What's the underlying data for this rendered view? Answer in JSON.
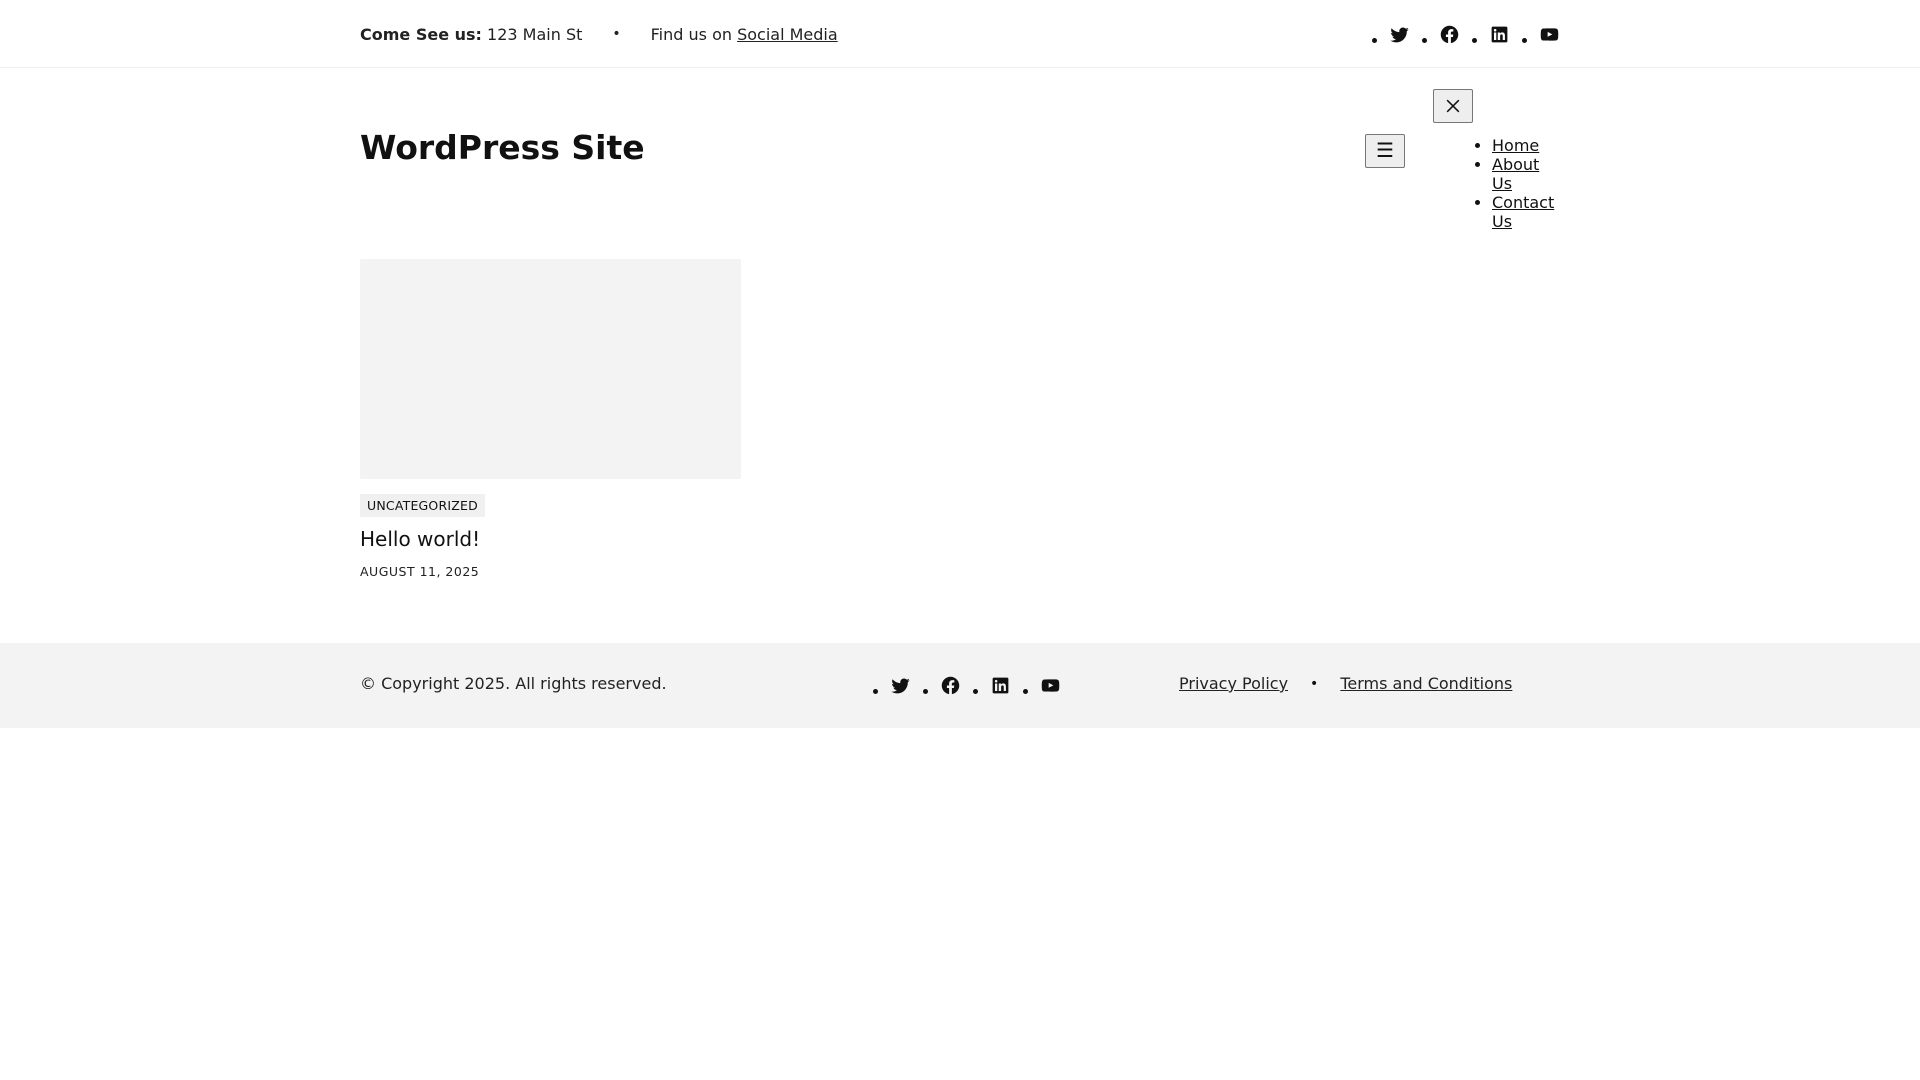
{
  "topbar": {
    "address_label": "Come See us:",
    "address_value": "123 Main St",
    "separator": "•",
    "social_prefix": "Find us on",
    "social_link": "Social Media",
    "social_icons": [
      "twitter-icon",
      "facebook-icon",
      "linkedin-icon",
      "youtube-icon"
    ]
  },
  "header": {
    "site_title": "WordPress Site",
    "menu_open_glyph": "☰",
    "menu_close_icon": "close-icon",
    "nav": [
      {
        "label": "Home"
      },
      {
        "label": "About Us"
      },
      {
        "label": "Contact Us"
      }
    ]
  },
  "post": {
    "category": "UNCATEGORIZED",
    "title": "Hello world!",
    "date": "AUGUST 11, 2025"
  },
  "footer": {
    "copyright": "© Copyright 2025. All rights reserved.",
    "social_icons": [
      "twitter-icon",
      "facebook-icon",
      "linkedin-icon",
      "youtube-icon"
    ],
    "links": [
      {
        "label": "Privacy Policy"
      },
      {
        "label": "Terms and Conditions"
      }
    ],
    "separator": "•"
  },
  "colors": {
    "text": "#111111",
    "thumb_bg": "#f3f3f3",
    "footer_bg": "#f3f3f3",
    "category_bg": "#f0f0f0"
  }
}
